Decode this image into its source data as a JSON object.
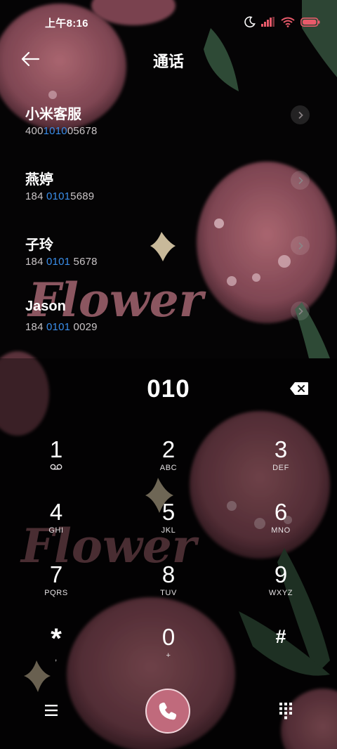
{
  "status_bar": {
    "time": "上午8:16"
  },
  "header": {
    "title": "通话",
    "back_icon": "arrow-left-icon"
  },
  "contacts": [
    {
      "name": "小米客服",
      "number_parts": [
        "400",
        "1010",
        "05678"
      ]
    },
    {
      "name": "燕婷",
      "number_parts": [
        "184 ",
        "0101",
        "5689"
      ]
    },
    {
      "name": "子玲",
      "number_parts": [
        "184 ",
        "0101",
        " 5678"
      ]
    },
    {
      "name": "Jason",
      "number_parts": [
        "184 ",
        "0101",
        " 0029"
      ]
    }
  ],
  "dialer": {
    "entry": "010",
    "keys": [
      {
        "digit": "1",
        "letters": "",
        "sub_icon": "voicemail-icon"
      },
      {
        "digit": "2",
        "letters": "ABC"
      },
      {
        "digit": "3",
        "letters": "DEF"
      },
      {
        "digit": "4",
        "letters": "GHI"
      },
      {
        "digit": "5",
        "letters": "JKL"
      },
      {
        "digit": "6",
        "letters": "MNO"
      },
      {
        "digit": "7",
        "letters": "PQRS"
      },
      {
        "digit": "8",
        "letters": "TUV"
      },
      {
        "digit": "9",
        "letters": "WXYZ"
      },
      {
        "digit": "*",
        "letters": ","
      },
      {
        "digit": "0",
        "letters": "+"
      },
      {
        "digit": "#",
        "letters": ""
      }
    ]
  },
  "wallpaper_text": "Flower",
  "colors": {
    "highlight": "#3a8eea",
    "call_button": "#c06a7c",
    "tulip": "#a2606c",
    "leaf": "#2e4a36"
  }
}
